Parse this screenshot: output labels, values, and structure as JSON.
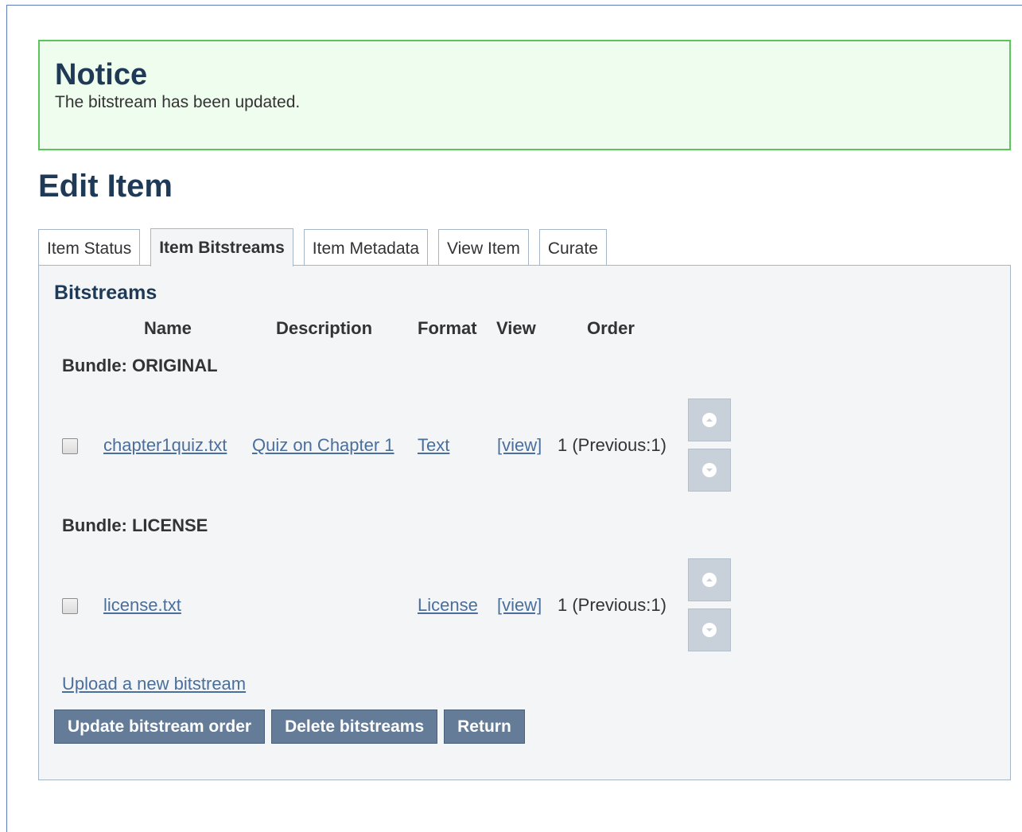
{
  "notice": {
    "title": "Notice",
    "message": "The bitstream has been updated."
  },
  "page_title": "Edit Item",
  "tabs": [
    {
      "label": "Item Status",
      "active": false
    },
    {
      "label": "Item Bitstreams",
      "active": true
    },
    {
      "label": "Item Metadata",
      "active": false
    },
    {
      "label": "View Item",
      "active": false
    },
    {
      "label": "Curate",
      "active": false
    }
  ],
  "bitstreams": {
    "heading": "Bitstreams",
    "columns": {
      "name": "Name",
      "description": "Description",
      "format": "Format",
      "view": "View",
      "order": "Order"
    },
    "bundles": [
      {
        "label": "Bundle: ORIGINAL",
        "rows": [
          {
            "name": "chapter1quiz.txt",
            "description": "Quiz on Chapter 1",
            "format": "Text",
            "view": "[view]",
            "order": "1 (Previous:1)",
            "checked": false
          }
        ]
      },
      {
        "label": "Bundle: LICENSE",
        "rows": [
          {
            "name": "license.txt",
            "description": "",
            "format": "License",
            "view": "[view]",
            "order": "1 (Previous:1)",
            "checked": false
          }
        ]
      }
    ],
    "upload_link": "Upload a new bitstream",
    "buttons": {
      "update_order": "Update bitstream order",
      "delete": "Delete bitstreams",
      "return": "Return"
    }
  },
  "icons": {
    "move_up": "arrow-up-icon",
    "move_down": "arrow-down-icon"
  },
  "colors": {
    "notice_bg": "#effdee",
    "notice_border": "#5bc45b",
    "heading": "#1f3a57",
    "link": "#4a6f9c",
    "button_bg": "#647c98",
    "order_button_bg": "#c8d0da"
  }
}
